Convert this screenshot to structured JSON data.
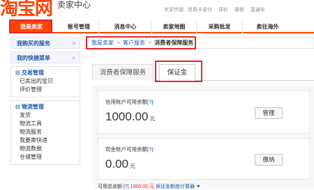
{
  "header": {
    "logo_text": "淘宝网",
    "logo_sub": "卖家中心",
    "hot_label": "卖家热搜:",
    "hot_links": [
      "信用卡支付",
      "评价",
      "装修",
      "直通车"
    ]
  },
  "nav": {
    "items": [
      {
        "label": "我是卖家",
        "active": true
      },
      {
        "label": "账号管理"
      },
      {
        "label": "消息中心"
      },
      {
        "label": "卖家地图"
      },
      {
        "label": "采购批发"
      },
      {
        "label": "卖往海外"
      }
    ]
  },
  "sidebar": {
    "bought": "我购买的服务",
    "quickmenu": "我的快捷菜单",
    "chevron": ">",
    "sections": [
      {
        "title": "交易管理",
        "items": [
          "已卖出的宝贝",
          "评价管理"
        ]
      },
      {
        "title": "物流管理",
        "items": [
          "发货",
          "物流工具",
          "物流服务",
          "我要寄快递",
          "物流数据",
          "仓储管理"
        ]
      }
    ],
    "toggle": "⊟"
  },
  "breadcrumb": {
    "items": [
      "我是卖家",
      "客户服务"
    ],
    "current": "消费者保障服务",
    "sep": ">"
  },
  "tabs": [
    "消费者保障服务",
    "保证金"
  ],
  "credit": {
    "label": "信用账户可用余额",
    "help": "[?]",
    "colon": ":",
    "amount": "1000.00",
    "unit": "元",
    "button": "管理"
  },
  "cash": {
    "label": "现金账户可用余额",
    "help": "[?]",
    "colon": ":",
    "amount": "0.00",
    "unit": "元",
    "button": "缴纳"
  },
  "footer": {
    "label": "可用总余额",
    "help": "[?]",
    "amount": "1000.00",
    "unit": "元",
    "link": "保证金额度计算器 ▼"
  },
  "colors": {
    "accent": "#ff4400",
    "highlight_box": "#e0262c",
    "link": "#1e5aa8"
  }
}
